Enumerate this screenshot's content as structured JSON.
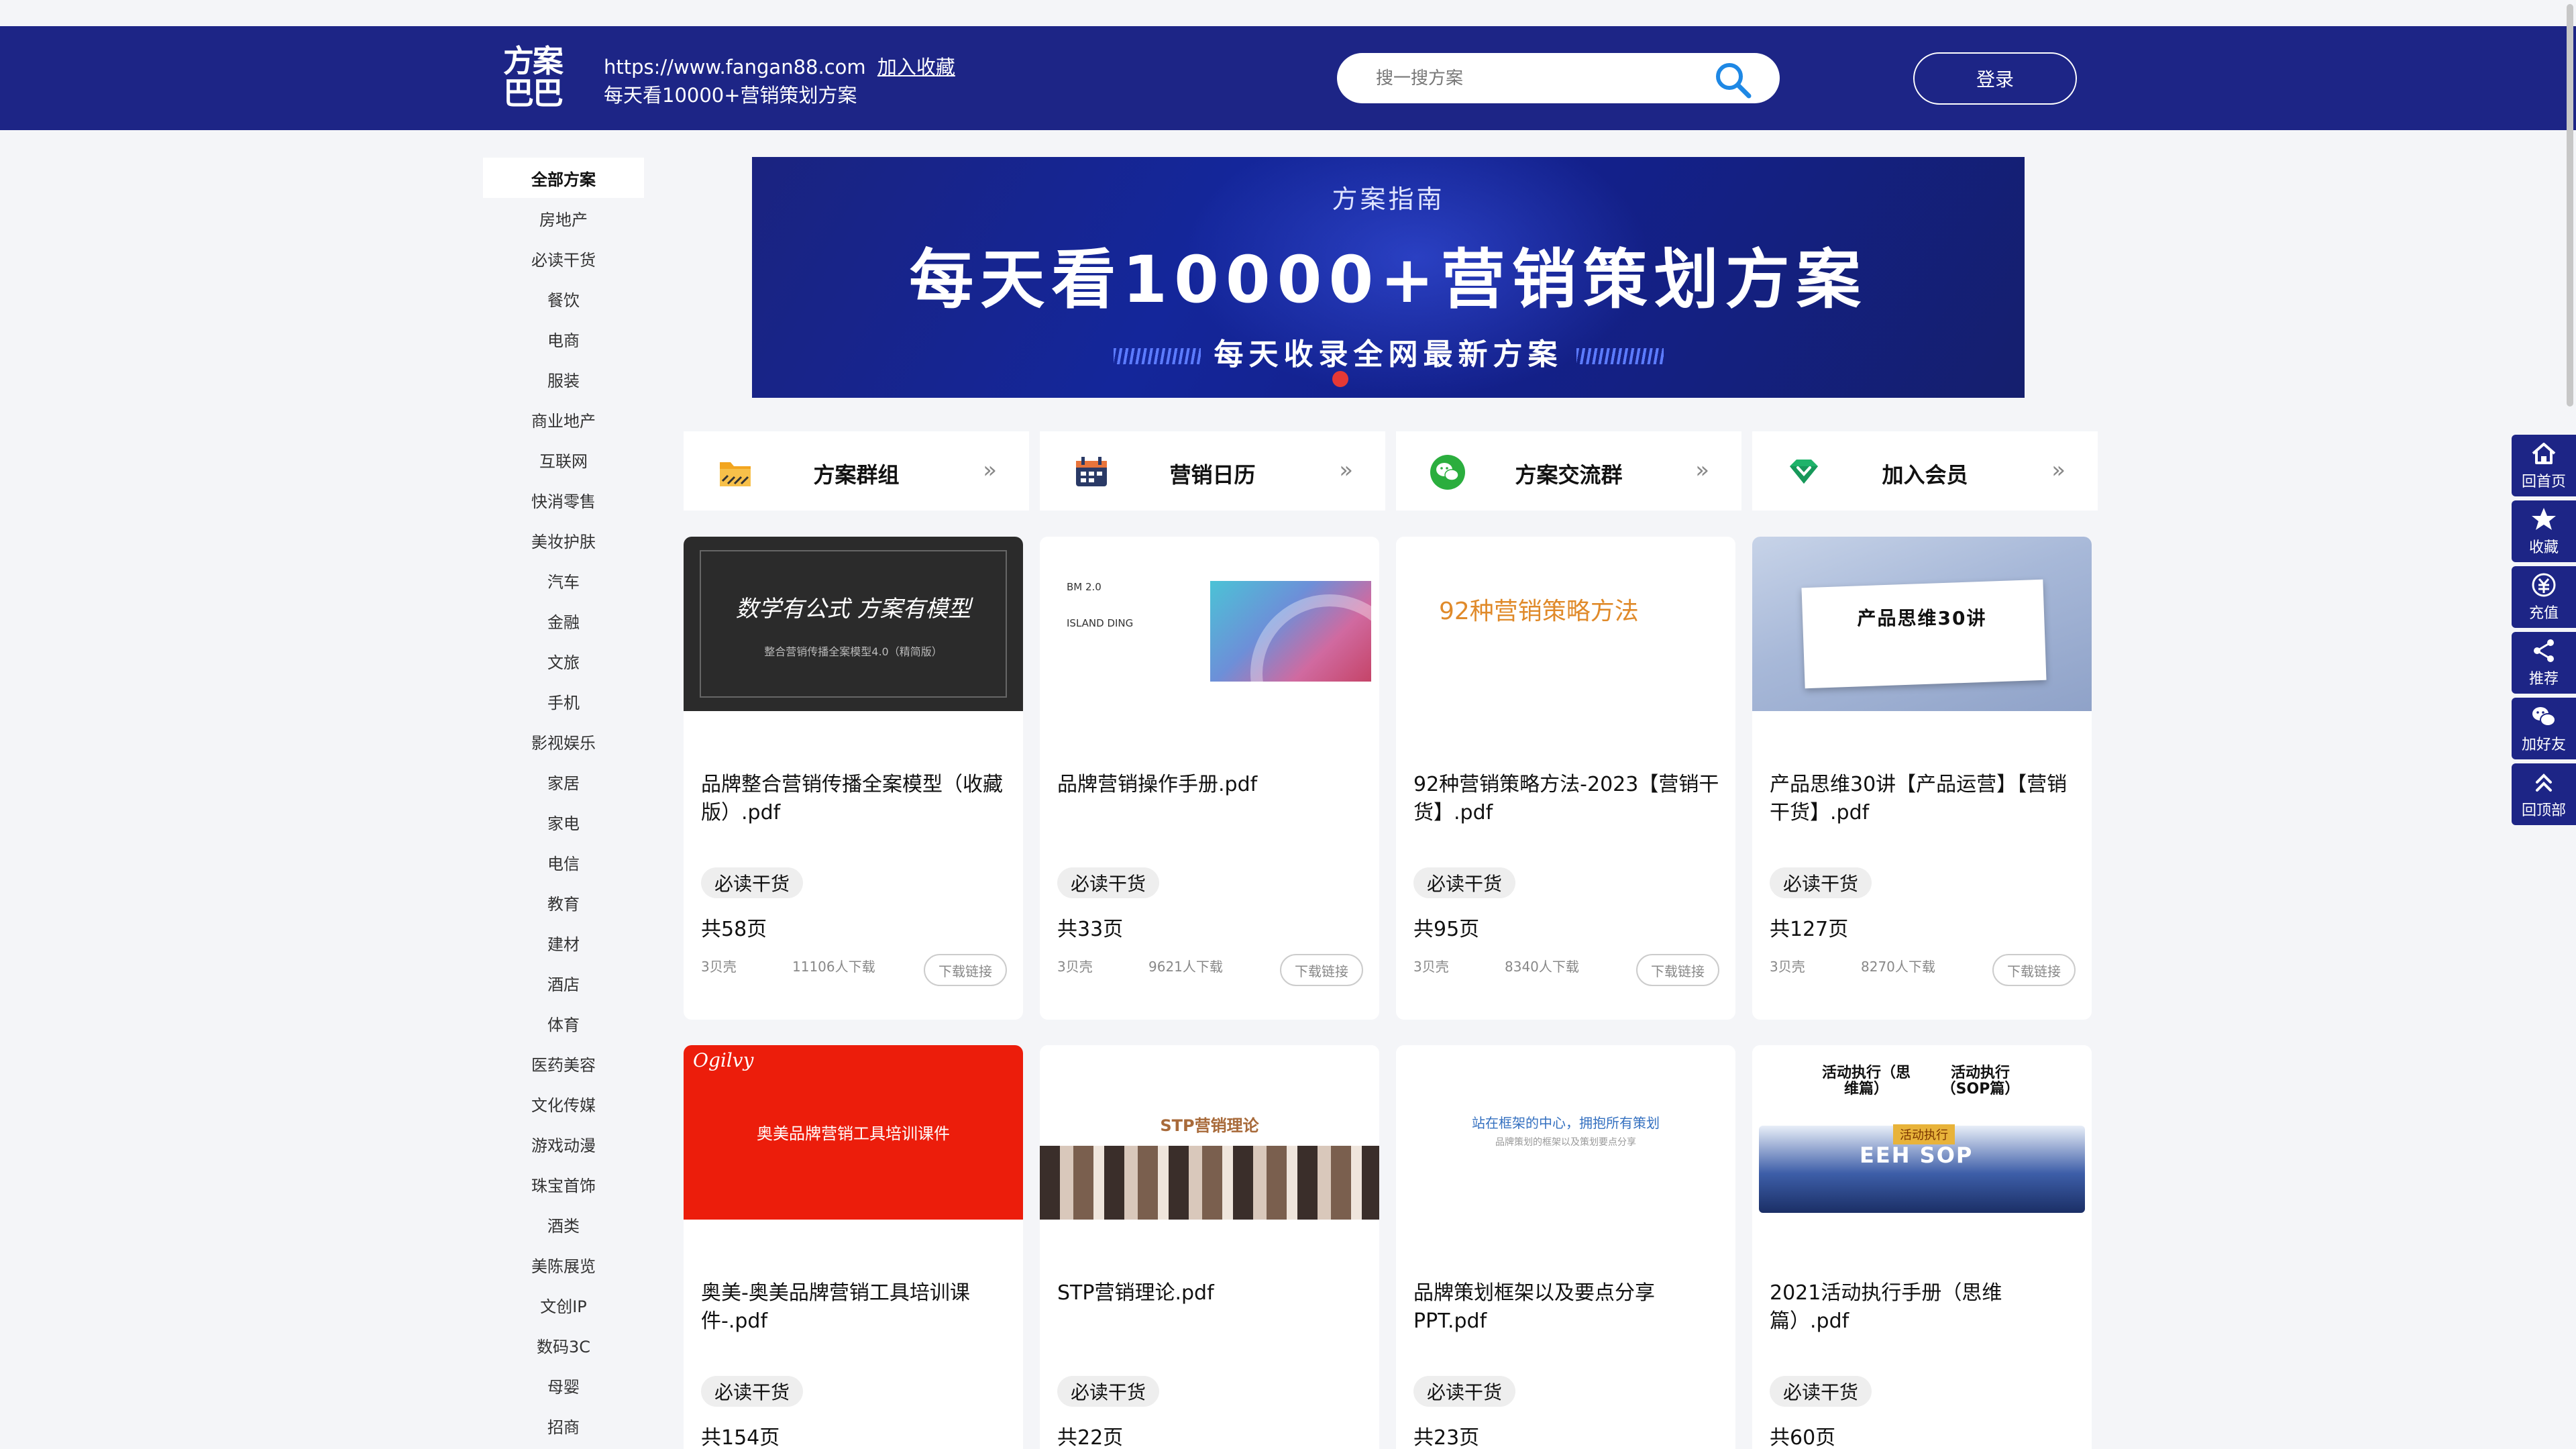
{
  "header": {
    "logo_text": "方案巴巴",
    "url": "https://www.fangan88.com",
    "favorite": "加入收藏",
    "slogan": "每天看10000+营销策划方案",
    "search_placeholder": "搜一搜方案",
    "login": "登录"
  },
  "sidebar": {
    "items": [
      "全部方案",
      "房地产",
      "必读干货",
      "餐饮",
      "电商",
      "服装",
      "商业地产",
      "互联网",
      "快消零售",
      "美妆护肤",
      "汽车",
      "金融",
      "文旅",
      "手机",
      "影视娱乐",
      "家居",
      "家电",
      "电信",
      "教育",
      "建材",
      "酒店",
      "体育",
      "医药美容",
      "文化传媒",
      "游戏动漫",
      "珠宝首饰",
      "酒类",
      "美陈展览",
      "文创IP",
      "数码3C",
      "母婴",
      "招商"
    ]
  },
  "banner": {
    "subtitle": "方案指南",
    "title": "每天看10000+营销策划方案",
    "tagline": "每天收录全网最新方案"
  },
  "quick_links": [
    {
      "label": "方案群组",
      "icon": "folder-icon"
    },
    {
      "label": "营销日历",
      "icon": "calendar-icon"
    },
    {
      "label": "方案交流群",
      "icon": "wechat-icon"
    },
    {
      "label": "加入会员",
      "icon": "vip-diamond-icon"
    }
  ],
  "cards": [
    {
      "title": "品牌整合营销传播全案模型（收藏版）.pdf",
      "tag": "必读干货",
      "pages": "共58页",
      "shells": "3贝壳",
      "downloads": "11106人下载",
      "download_label": "下载链接",
      "thumb_title": "数学有公式 方案有模型",
      "thumb_sub": "整合营销传播全案模型4.0（精简版）"
    },
    {
      "title": "品牌营销操作手册.pdf",
      "tag": "必读干货",
      "pages": "共33页",
      "shells": "3贝壳",
      "downloads": "9621人下载",
      "download_label": "下载链接",
      "thumb_title": "BM 2.0",
      "thumb_sub": "ISLAND DING"
    },
    {
      "title": "92种营销策略方法-2023【营销干货】.pdf",
      "tag": "必读干货",
      "pages": "共95页",
      "shells": "3贝壳",
      "downloads": "8340人下载",
      "download_label": "下载链接",
      "thumb_title": "92种营销策略方法",
      "thumb_sub": ""
    },
    {
      "title": "产品思维30讲【产品运营】【营销干货】.pdf",
      "tag": "必读干货",
      "pages": "共127页",
      "shells": "3贝壳",
      "downloads": "8270人下载",
      "download_label": "下载链接",
      "thumb_title": "产品思维30讲",
      "thumb_sub": ""
    },
    {
      "title": "奥美-奥美品牌营销工具培训课件-.pdf",
      "tag": "必读干货",
      "pages": "共154页",
      "thumb_title": "奥美品牌营销工具培训课件",
      "thumb_sub": "Ogilvy"
    },
    {
      "title": "STP营销理论.pdf",
      "tag": "必读干货",
      "pages": "共22页",
      "thumb_title": "STP营销理论",
      "thumb_sub": ""
    },
    {
      "title": "品牌策划框架以及要点分享PPT.pdf",
      "tag": "必读干货",
      "pages": "共23页",
      "thumb_title": "站在框架的中心，拥抱所有策划",
      "thumb_sub": "品牌策划的框架以及策划要点分享"
    },
    {
      "title": "2021活动执行手册（思维篇）.pdf",
      "tag": "必读干货",
      "pages": "共60页",
      "thumb_title": "活动执行（思维篇）",
      "thumb_title2": "活动执行（SOP篇）",
      "thumb_label": "EEH SOP",
      "thumb_ribbon": "活动执行"
    }
  ],
  "toolbar": [
    {
      "label": "回首页",
      "icon": "home-icon"
    },
    {
      "label": "收藏",
      "icon": "star-icon"
    },
    {
      "label": "充值",
      "icon": "recharge-icon"
    },
    {
      "label": "推荐",
      "icon": "share-icon"
    },
    {
      "label": "加好友",
      "icon": "wechat-icon"
    },
    {
      "label": "回顶部",
      "icon": "back-top-icon"
    }
  ],
  "colors": {
    "brand": "#1d2586",
    "accent_red": "#e53935"
  }
}
